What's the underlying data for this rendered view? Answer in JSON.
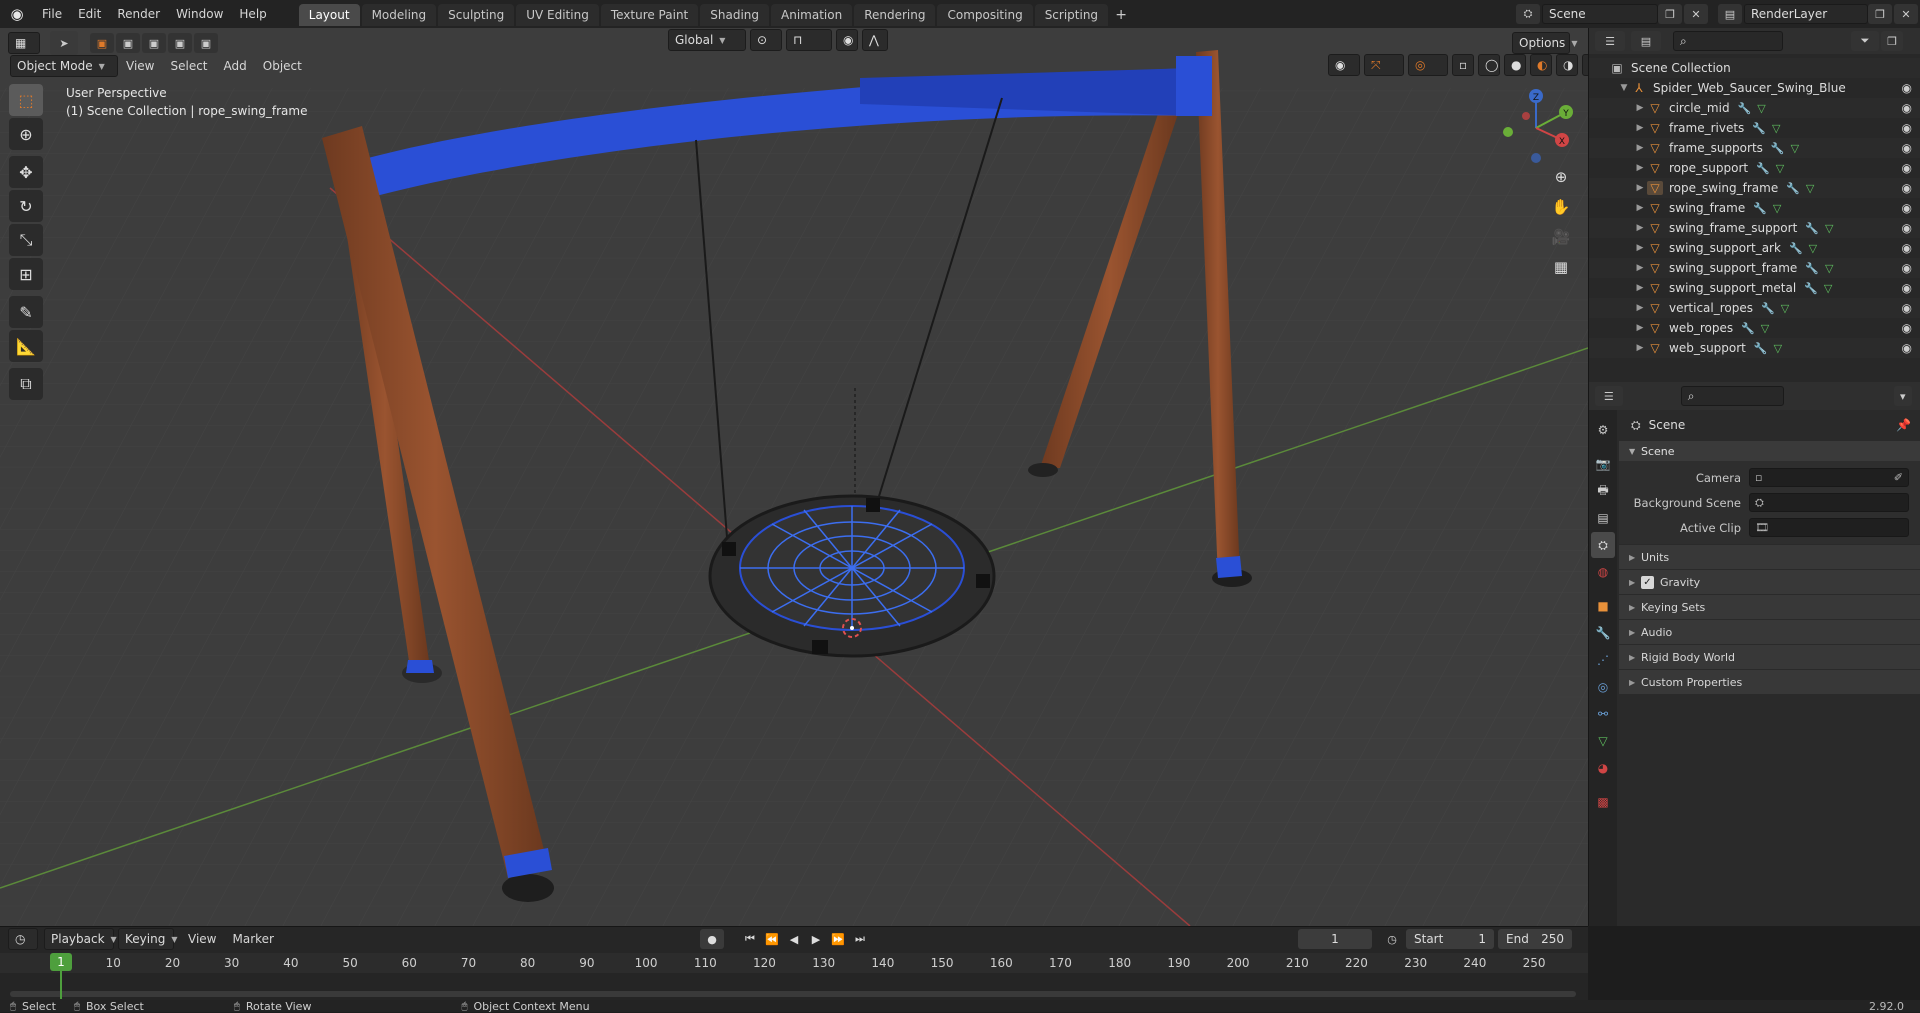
{
  "menubar": {
    "items": [
      "File",
      "Edit",
      "Render",
      "Window",
      "Help"
    ],
    "workspaces": [
      "Layout",
      "Modeling",
      "Sculpting",
      "UV Editing",
      "Texture Paint",
      "Shading",
      "Animation",
      "Rendering",
      "Compositing",
      "Scripting"
    ],
    "active_workspace": "Layout",
    "scene_name": "Scene",
    "view_layer": "RenderLayer"
  },
  "viewport": {
    "mode": "Object Mode",
    "menus": [
      "View",
      "Select",
      "Add",
      "Object"
    ],
    "transform_orientation": "Global",
    "options_label": "Options",
    "info_line1": "User Perspective",
    "info_line2": "(1) Scene Collection | rope_swing_frame",
    "gizmo": {
      "x": "X",
      "y": "Y",
      "z": "Z"
    }
  },
  "outliner": {
    "collection": "Scene Collection",
    "root": "Spider_Web_Saucer_Swing_Blue",
    "objects": [
      "circle_mid",
      "frame_rivets",
      "frame_supports",
      "rope_support",
      "rope_swing_frame",
      "swing_frame",
      "swing_frame_support",
      "swing_support_ark",
      "swing_support_frame",
      "swing_support_metal",
      "vertical_ropes",
      "web_ropes",
      "web_support"
    ]
  },
  "properties": {
    "context": "Scene",
    "panel": "Scene",
    "camera_label": "Camera",
    "background_scene_label": "Background Scene",
    "active_clip_label": "Active Clip",
    "sections": [
      "Units",
      "Gravity",
      "Keying Sets",
      "Audio",
      "Rigid Body World",
      "Custom Properties"
    ],
    "gravity_checked": true
  },
  "timeline": {
    "menus": [
      "Playback",
      "Keying",
      "View",
      "Marker"
    ],
    "current_frame": "1",
    "start_label": "Start",
    "start": "1",
    "end_label": "End",
    "end": "250",
    "ticks": [
      "10",
      "20",
      "30",
      "40",
      "50",
      "60",
      "70",
      "80",
      "90",
      "100",
      "110",
      "120",
      "130",
      "140",
      "150",
      "160",
      "170",
      "180",
      "190",
      "200",
      "210",
      "220",
      "230",
      "240",
      "250"
    ]
  },
  "statusbar": {
    "select": "Select",
    "box_select": "Box Select",
    "rotate_view": "Rotate View",
    "context_menu": "Object Context Menu",
    "version": "2.92.0"
  },
  "colors": {
    "accent_orange": "#e8913a",
    "active_green": "#4e9f3d",
    "frame_blue": "#2a4fd6",
    "wood": "#8a4a2a"
  }
}
